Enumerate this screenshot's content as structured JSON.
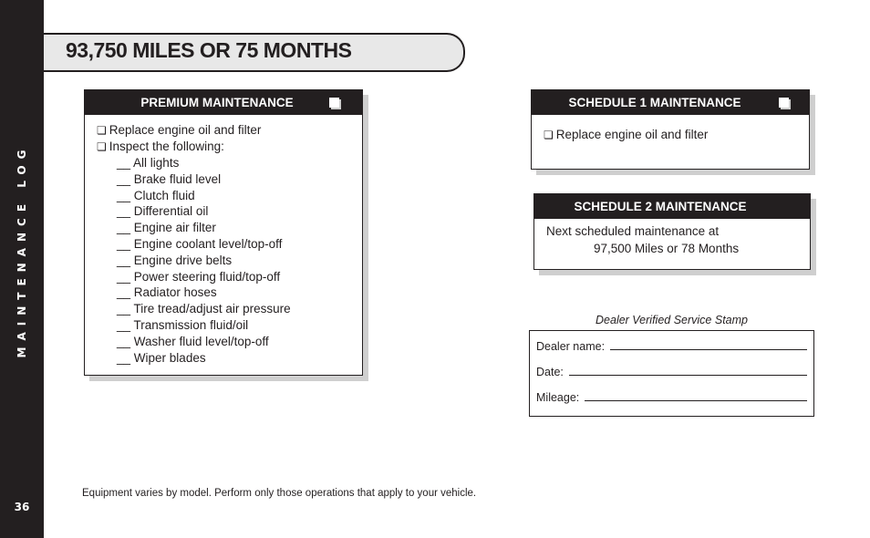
{
  "sidebar": {
    "section_label": "MAINTENANCE LOG",
    "page_number": "36"
  },
  "header": {
    "title": "93,750 MILES OR 75 MONTHS"
  },
  "premium": {
    "title": "PREMIUM MAINTENANCE",
    "items": [
      "Replace engine oil and filter",
      "Inspect the following:"
    ],
    "checkbox_glyph": "❏",
    "blank": "__",
    "inspections": [
      "All lights",
      "Brake fluid level",
      "Clutch fluid",
      "Differential oil",
      "Engine air filter",
      "Engine coolant level/top-off",
      "Engine drive belts",
      "Power steering fluid/top-off",
      "Radiator hoses",
      "Tire tread/adjust air pressure",
      "Transmission fluid/oil",
      "Washer fluid level/top-off",
      "Wiper blades"
    ]
  },
  "schedule1": {
    "title": "SCHEDULE 1 MAINTENANCE",
    "items": [
      "Replace engine oil and filter"
    ]
  },
  "schedule2": {
    "title": "SCHEDULE 2 MAINTENANCE",
    "line1": "Next scheduled maintenance at",
    "line2": "97,500 Miles or 78 Months"
  },
  "stamp": {
    "caption": "Dealer Verified Service Stamp",
    "dealer_label": "Dealer name:",
    "date_label": "Date:",
    "mileage_label": "Mileage:"
  },
  "footnote": "Equipment varies by model. Perform only those operations that apply to your vehicle."
}
